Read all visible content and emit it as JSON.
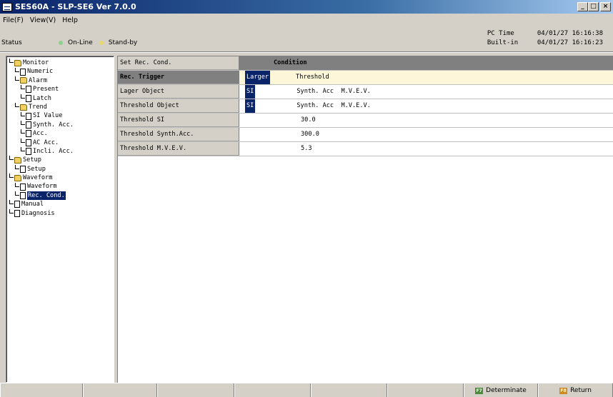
{
  "window": {
    "title": "SES60A - SLP-SE6 Ver 7.0.0"
  },
  "menu": [
    "File(F)",
    "View(V)",
    "Help"
  ],
  "status": {
    "label": "Status",
    "online": "On-Line",
    "standby": "Stand-by"
  },
  "time": {
    "pc_label": "PC Time",
    "pc_value": "04/01/27 16:16:38",
    "builtin_label": "Built-in",
    "builtin_value": "04/01/27 16:16:23"
  },
  "tree": [
    {
      "label": "Monitor",
      "type": "folder",
      "level": 0
    },
    {
      "label": "Numeric",
      "type": "doc",
      "level": 1
    },
    {
      "label": "Alarm",
      "type": "folder",
      "level": 1
    },
    {
      "label": "Present",
      "type": "doc",
      "level": 2
    },
    {
      "label": "Latch",
      "type": "doc",
      "level": 2
    },
    {
      "label": "Trend",
      "type": "folder",
      "level": 1
    },
    {
      "label": "SI Value",
      "type": "doc",
      "level": 2
    },
    {
      "label": "Synth. Acc.",
      "type": "doc",
      "level": 2
    },
    {
      "label": "Acc.",
      "type": "doc",
      "level": 2
    },
    {
      "label": "AC Acc.",
      "type": "doc",
      "level": 2
    },
    {
      "label": "Incli. Acc.",
      "type": "doc",
      "level": 2
    },
    {
      "label": "Setup",
      "type": "folder",
      "level": 0
    },
    {
      "label": "Setup",
      "type": "doc",
      "level": 1
    },
    {
      "label": "Waveform",
      "type": "folder",
      "level": 0
    },
    {
      "label": "Waveform",
      "type": "doc",
      "level": 1
    },
    {
      "label": "Rec. Cond.",
      "type": "doc",
      "level": 1,
      "selected": true
    },
    {
      "label": "Manual",
      "type": "doc",
      "level": 0
    },
    {
      "label": "Diagnosis",
      "type": "doc",
      "level": 0
    }
  ],
  "grid": {
    "header_label": "Set Rec. Cond.",
    "header_value": "Condition",
    "rows": [
      {
        "label": "Rec. Trigger",
        "sel": "Larger",
        "value": "Threshold",
        "pad": "    "
      },
      {
        "label": "Lager Object",
        "sel": "SI",
        "value": "Synth. Acc  M.V.E.V.",
        "pad": "        "
      },
      {
        "label": "Threshold Object",
        "sel": "SI",
        "value": "Synth. Acc  M.V.E.V.",
        "pad": "        "
      },
      {
        "label": "Threshold SI",
        "sel": "",
        "value": "30.0",
        "pad": ""
      },
      {
        "label": "Threshold Synth.Acc.",
        "sel": "",
        "value": "300.0",
        "pad": ""
      },
      {
        "label": "Threshold M.V.E.V.",
        "sel": "",
        "value": "5.3",
        "pad": ""
      }
    ]
  },
  "footer": {
    "f7_label": "Determinate",
    "f8_label": "Return",
    "f7_key": "F7",
    "f8_key": "F8"
  }
}
